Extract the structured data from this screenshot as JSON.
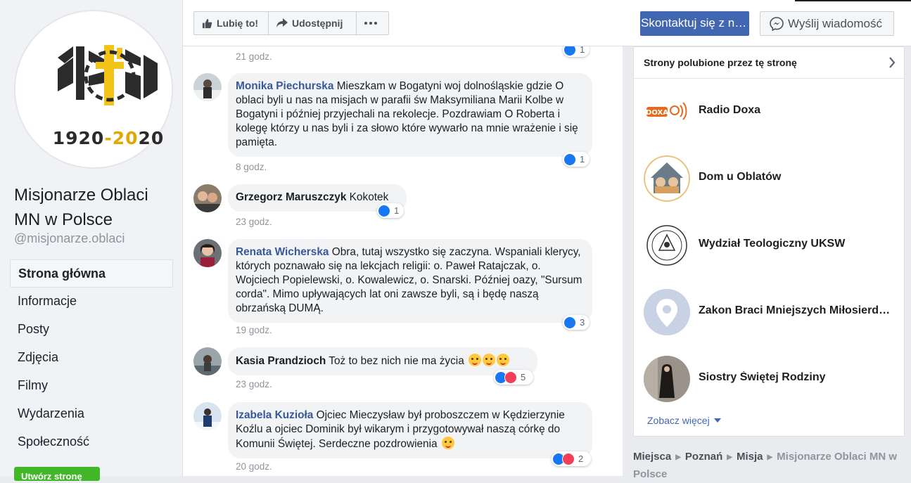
{
  "page": {
    "logo_text": "1920-2020",
    "name": "Misjonarze Oblaci MN w Polsce",
    "handle": "@misjonarze.oblaci"
  },
  "nav": {
    "items": [
      {
        "label": "Strona główna",
        "active": true
      },
      {
        "label": "Informacje"
      },
      {
        "label": "Posty"
      },
      {
        "label": "Zdjęcia"
      },
      {
        "label": "Filmy"
      },
      {
        "label": "Wydarzenia"
      },
      {
        "label": "Społeczność"
      }
    ],
    "create_button": "Utwórz stronę"
  },
  "actions": {
    "like": "Lubię to!",
    "share": "Udostępnij",
    "more_icon": "ellipsis-icon",
    "contact": "Skontaktuj się z nami",
    "message": "Wyślij wiadomość",
    "accent": "#4267b2"
  },
  "comments": [
    {
      "time": "21 godz.",
      "reactions": "1"
    },
    {
      "author": "Monika Piechurska",
      "text": "Mieszkam w Bogatyni woj dolnośląskie gdzie O oblaci byli u nas na misjach w parafii św Maksymiliana Marii Kolbe w Bogatyni i później przyjechali na rekolecje. Pozdrawiam O Roberta i kolegę którzy u nas byli i za słowo które wywarło na mnie wrażenie i się pamięta.",
      "time": "8 godz.",
      "reactions": "1"
    },
    {
      "author": "Grzegorz Maruszczyk",
      "text": "Kokotek",
      "time": "23 godz.",
      "reactions": "1"
    },
    {
      "author": "Renata Wicherska",
      "text": "Obra, tutaj wszystko się zaczyna. Wspaniali klerycy, których poznawało się na lekcjach religii: o. Paweł Ratajczak, o. Wojciech Popielewski, o. Kowalewicz, o. Snarski. Później oazy, \"Sursum corda\". Mimo upływających lat oni zawsze byli, są i będę naszą obrzańską DUMĄ.",
      "time": "19 godz.",
      "reactions": "3"
    },
    {
      "author": "Kasia Prandzioch",
      "text": "Toż to bez nich nie ma życia",
      "time": "23 godz.",
      "reactions": "5"
    },
    {
      "author": "Izabela Kuzioła",
      "text": "Ojciec Mieczysław był proboszczem w Kędzierzynie Koźlu a ojciec Dominik był wikarym i przygotowywał naszą córkę do Komunii Świętej. Serdeczne pozdrowienia",
      "time": "20 godz.",
      "reactions": "2"
    }
  ],
  "liked_pages": {
    "title": "Strony polubione przez tę stronę",
    "items": [
      {
        "name": "Radio Doxa",
        "icon_text": "DOXA"
      },
      {
        "name": "Dom u Oblatów"
      },
      {
        "name": "Wydział Teologiczny UKSW"
      },
      {
        "name": "Zakon Braci Mniejszych Miłosierdzia"
      },
      {
        "name": "Siostry Świętej Rodziny"
      }
    ],
    "see_more": "Zobacz więcej"
  },
  "breadcrumb": [
    "Miejsca",
    "Poznań",
    "Misja",
    "Misjonarze Oblaci MN w Polsce"
  ]
}
